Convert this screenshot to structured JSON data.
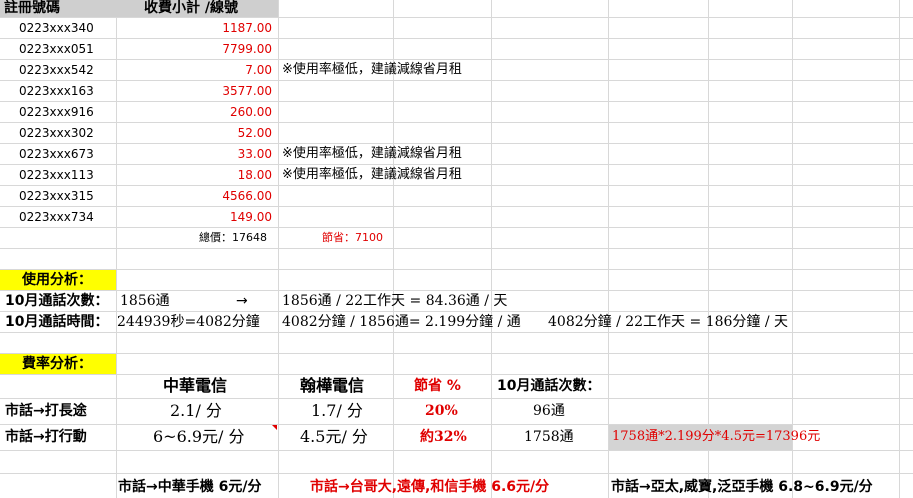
{
  "header": {
    "col1": "註冊號碼",
    "col2": "收費小計 /線號"
  },
  "rows": [
    {
      "id": "0223xxx340",
      "fee": "1187.00",
      "note": ""
    },
    {
      "id": "0223xxx051",
      "fee": "7799.00",
      "note": ""
    },
    {
      "id": "0223xxx542",
      "fee": "7.00",
      "note": "※使用率極低，建議減線省月租"
    },
    {
      "id": "0223xxx163",
      "fee": "3577.00",
      "note": ""
    },
    {
      "id": "0223xxx916",
      "fee": "260.00",
      "note": ""
    },
    {
      "id": "0223xxx302",
      "fee": "52.00",
      "note": ""
    },
    {
      "id": "0223xxx673",
      "fee": "33.00",
      "note": "※使用率極低，建議減線省月租"
    },
    {
      "id": "0223xxx113",
      "fee": "18.00",
      "note": "※使用率極低，建議減線省月租"
    },
    {
      "id": "0223xxx315",
      "fee": "4566.00",
      "note": ""
    },
    {
      "id": "0223xxx734",
      "fee": "149.00",
      "note": ""
    }
  ],
  "summary": {
    "total": "總價：17648",
    "saving": "節省：7100"
  },
  "usage": {
    "title": "使用分析：",
    "calls_label": "10月通話次數：",
    "calls_value": "1856通",
    "arrow": "→",
    "calls_calc": "1856通 / 22工作天 = 84.36通 / 天",
    "time_label": "10月通話時間：",
    "time_value": "244939秒=4082分鐘",
    "time_calc1": "4082分鐘 / 1856通= 2.199分鐘 / 通",
    "time_calc2": "4082分鐘 / 22工作天 = 186分鐘 / 天"
  },
  "rate": {
    "title": "費率分析：",
    "col_cht": "中華電信",
    "col_han": "翰樺電信",
    "col_save": "節省 %",
    "col_calls": "10月通話次數：",
    "row1": {
      "label": "市話→打長途",
      "cht": "2.1/ 分",
      "han": "1.7/ 分",
      "save": "20%",
      "calls": "96通"
    },
    "row2": {
      "label": "市話→打行動",
      "cht": "6~6.9元/ 分",
      "han": "4.5元/ 分",
      "save": "約32%",
      "calls": "1758通",
      "calc": "1758通*2.199分*4.5元=17396元"
    }
  },
  "footer": {
    "f1": "市話→中華手機 6元/分",
    "f2": "市話→台哥大,遠傳,和信手機 6.6元/分",
    "f3": "市話→亞太,威寶,泛亞手機 6.8~6.9元/分"
  }
}
